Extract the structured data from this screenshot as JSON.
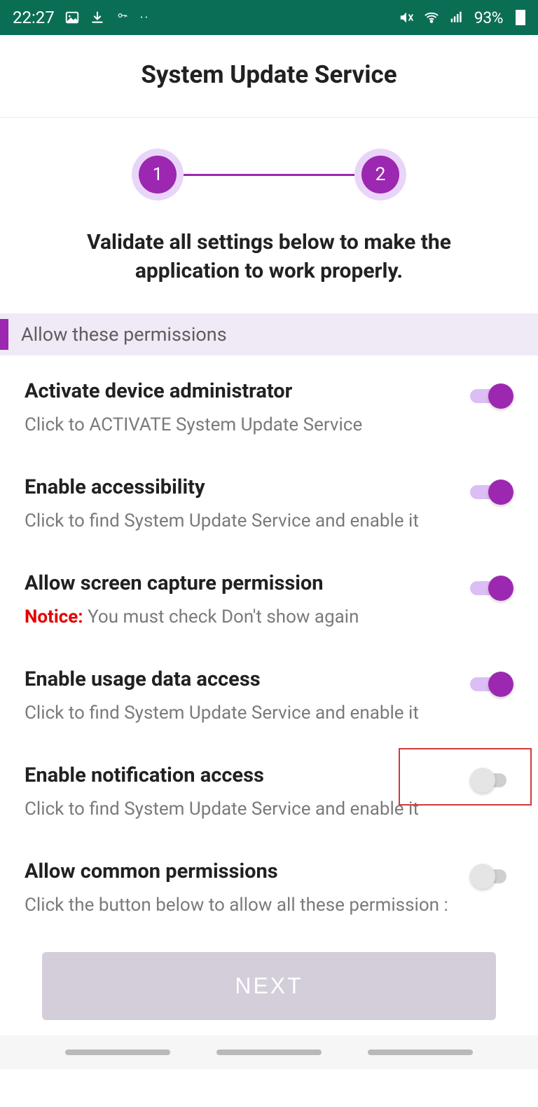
{
  "status": {
    "time": "22:27",
    "battery": "93%"
  },
  "header": {
    "title": "System Update Service"
  },
  "stepper": {
    "step1": "1",
    "step2": "2"
  },
  "subtitle": "Validate all settings below to make the application to work properly.",
  "section": {
    "permissions_label": "Allow these permissions"
  },
  "permissions": [
    {
      "title": "Activate device administrator",
      "desc": "Click to ACTIVATE System Update Service",
      "on": true,
      "highlight": false,
      "notice": ""
    },
    {
      "title": "Enable accessibility",
      "desc": "Click to find System Update Service and enable it",
      "on": true,
      "highlight": false,
      "notice": ""
    },
    {
      "title": "Allow screen capture permission",
      "desc": "You must check Don't show again",
      "on": true,
      "highlight": false,
      "notice": "Notice: "
    },
    {
      "title": "Enable usage data access",
      "desc": "Click to find System Update Service and enable it",
      "on": true,
      "highlight": false,
      "notice": ""
    },
    {
      "title": "Enable notification access",
      "desc": "Click to find System Update Service and enable it",
      "on": false,
      "highlight": true,
      "notice": ""
    },
    {
      "title": "Allow common permissions",
      "desc": "Click the button below to allow all these permission  :",
      "on": false,
      "highlight": false,
      "notice": ""
    }
  ],
  "next_label": "NEXT"
}
